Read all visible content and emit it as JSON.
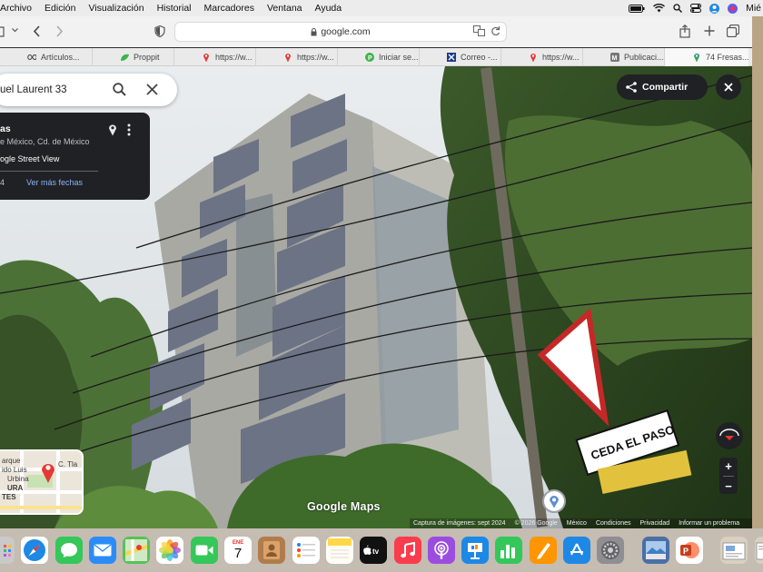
{
  "menubar": {
    "items": [
      "Archivo",
      "Edición",
      "Visualización",
      "Historial",
      "Marcadores",
      "Ventana",
      "Ayuda"
    ],
    "clock_partial": "Mié"
  },
  "browser": {
    "address": "google.com",
    "bookmarks": [
      {
        "label": "Artículos...",
        "icon": "infinity-icon",
        "color": "#444"
      },
      {
        "label": "Proppit",
        "icon": "proppit-icon",
        "color": "#3cb44b"
      },
      {
        "label": "https://w...",
        "icon": "pin-icon",
        "color": "#e53935"
      },
      {
        "label": "https://w...",
        "icon": "pin-icon",
        "color": "#e53935"
      },
      {
        "label": "Iniciar se...",
        "icon": "p-icon",
        "color": "#3cb44b"
      },
      {
        "label": "Correo -...",
        "icon": "x-icon",
        "color": "#1d3a8a"
      },
      {
        "label": "https://w...",
        "icon": "pin-icon",
        "color": "#e53935"
      },
      {
        "label": "Publicaci...",
        "icon": "m-icon",
        "color": "#777"
      },
      {
        "label": "74 Fresas...",
        "icon": "maps-icon",
        "color": "#34a853"
      }
    ]
  },
  "maps": {
    "search_value": "uel Laurent 33",
    "card": {
      "title": "as",
      "subtitle": "e México, Cd. de México",
      "source": "ogle Street View",
      "date_partial": "4",
      "more_dates": "Ver más fechas"
    },
    "share_label": "Compartir",
    "logo": "Google Maps",
    "minimap_labels": [
      "arque",
      "ido Luis",
      "Urbina",
      "TES",
      "URA",
      "C. Tla"
    ],
    "zoom_in": "+",
    "zoom_out": "−",
    "sign_text": "CEDA EL PASO",
    "footer": {
      "capture": "Captura de imágenes: sept 2024",
      "copyright": "© 2026 Google",
      "country": "México",
      "terms": "Condiciones",
      "privacy": "Privacidad",
      "report": "Informar un problema"
    }
  },
  "dock": {
    "calendar_month": "ENE",
    "calendar_day": "7",
    "apps": [
      {
        "name": "launchpad-icon",
        "color": "#c9c9c9"
      },
      {
        "name": "safari-icon",
        "color": "#1e88e5"
      },
      {
        "name": "messages-icon",
        "color": "#34c759"
      },
      {
        "name": "mail-icon",
        "color": "#2b8cf7"
      },
      {
        "name": "maps-app-icon",
        "color": "#5ac05a"
      },
      {
        "name": "photos-icon",
        "color": "#f2f2f2"
      },
      {
        "name": "facetime-icon",
        "color": "#34c759"
      },
      {
        "name": "calendar-icon",
        "color": "#ffffff"
      },
      {
        "name": "contacts-icon",
        "color": "#b07d4a"
      },
      {
        "name": "reminders-icon",
        "color": "#ffffff"
      },
      {
        "name": "notes-icon",
        "color": "#ffd84a"
      },
      {
        "name": "appletv-icon",
        "color": "#111111"
      },
      {
        "name": "music-icon",
        "color": "#fa3c4c"
      },
      {
        "name": "podcasts-icon",
        "color": "#9b4de0"
      },
      {
        "name": "keynote-icon",
        "color": "#1e88e5"
      },
      {
        "name": "numbers-icon",
        "color": "#34c759"
      },
      {
        "name": "pages-icon",
        "color": "#ff9500"
      },
      {
        "name": "appstore-icon",
        "color": "#1e88e5"
      },
      {
        "name": "settings-icon",
        "color": "#8e8e93"
      },
      {
        "name": "preview-icon",
        "color": "#4a6fa5"
      },
      {
        "name": "powerpoint-icon",
        "color": "#d04423"
      },
      {
        "name": "downloads-icon",
        "color": "#d9d0c0"
      },
      {
        "name": "documents-icon",
        "color": "#d9d0c0"
      }
    ]
  }
}
